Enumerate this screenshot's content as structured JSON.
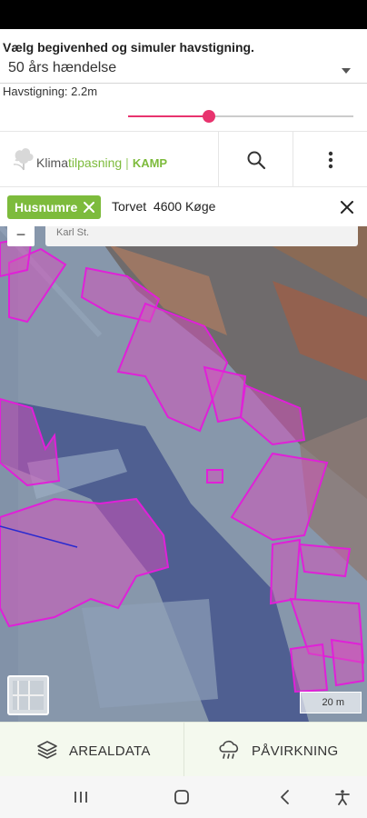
{
  "simulation": {
    "title": "Vælg begivenhed og simuler havstigning.",
    "event_selected": "50 års hændelse",
    "sea_level_label": "Havstigning: 2.2m",
    "sea_level_fraction": 0.36,
    "accent_color": "#e8336e"
  },
  "app_bar": {
    "brand_prefix": "Klima",
    "brand_accent": "tilpasning",
    "brand_separator": "|",
    "brand_product": "KAMP",
    "brand_color": "#7dbb3c",
    "icons": [
      "search-icon",
      "more-vert-icon"
    ]
  },
  "search": {
    "chip_label": "Husnumre",
    "query": "Torvet  4600 Køge"
  },
  "map": {
    "zoom_button": "−",
    "address_hint": "Karl St.",
    "scale_label": "20 m",
    "flood_color": "#7f93a8",
    "building_outline_color": "#e020d8"
  },
  "bottom_tabs": [
    {
      "label": "AREALDATA",
      "icon": "layers-icon"
    },
    {
      "label": "PÅVIRKNING",
      "icon": "cloud-rain-icon"
    }
  ],
  "system_nav": [
    "recent-apps-icon",
    "home-icon",
    "back-icon",
    "accessibility-icon"
  ]
}
